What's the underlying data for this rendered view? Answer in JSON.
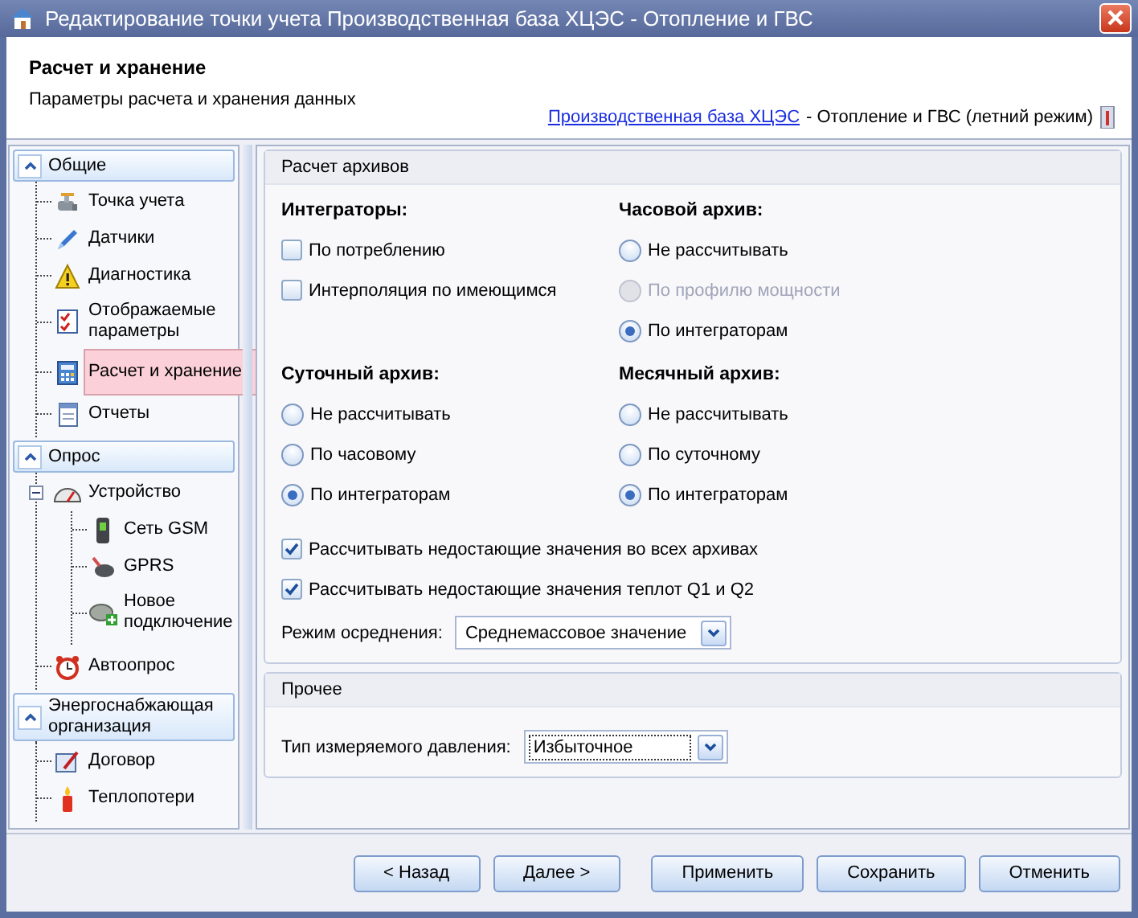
{
  "window": {
    "title": "Редактирование точки учета Производственная база ХЦЭС - Отопление и ГВС"
  },
  "header": {
    "title": "Расчет и хранение",
    "subtitle": "Параметры расчета и хранения данных",
    "link": "Производственная база ХЦЭС",
    "context": "- Отопление и ГВС (летний режим)"
  },
  "sidebar": {
    "groups": [
      {
        "label": "Общие",
        "expanded": true,
        "items": [
          {
            "label": "Точка учета",
            "selected": false
          },
          {
            "label": "Датчики",
            "selected": false
          },
          {
            "label": "Диагностика",
            "selected": false
          },
          {
            "label": "Отображаемые параметры",
            "selected": false
          },
          {
            "label": "Расчет и хранение",
            "selected": true
          },
          {
            "label": "Отчеты",
            "selected": false
          }
        ]
      },
      {
        "label": "Опрос",
        "expanded": true,
        "items": [
          {
            "label": "Устройство",
            "selected": false,
            "expanded": true,
            "children": [
              {
                "label": "Сеть GSM",
                "selected": false
              },
              {
                "label": "GPRS",
                "selected": false
              },
              {
                "label": "Новое подключение",
                "selected": false
              }
            ]
          },
          {
            "label": "Автоопрос",
            "selected": false
          }
        ]
      },
      {
        "label": "Энергоснабжающая организация",
        "expanded": true,
        "items": [
          {
            "label": "Договор",
            "selected": false
          },
          {
            "label": "Теплопотери",
            "selected": false
          }
        ]
      }
    ]
  },
  "sections": [
    {
      "title": "Расчет архивов",
      "groups": [
        {
          "title": "Интеграторы:",
          "kind": "checkbox",
          "options": [
            {
              "label": "По потреблению",
              "checked": false
            },
            {
              "label": "Интерполяция по имеющимся",
              "checked": false
            }
          ]
        },
        {
          "title": "Часовой архив:",
          "kind": "radio",
          "options": [
            {
              "label": "Не рассчитывать",
              "selected": false,
              "disabled": false
            },
            {
              "label": "По профилю мощности",
              "selected": false,
              "disabled": true
            },
            {
              "label": "По интеграторам",
              "selected": true,
              "disabled": false
            }
          ]
        },
        {
          "title": "Суточный архив:",
          "kind": "radio",
          "options": [
            {
              "label": "Не рассчитывать",
              "selected": false,
              "disabled": false
            },
            {
              "label": "По часовому",
              "selected": false,
              "disabled": false
            },
            {
              "label": "По интеграторам",
              "selected": true,
              "disabled": false
            }
          ]
        },
        {
          "title": "Месячный архив:",
          "kind": "radio",
          "options": [
            {
              "label": "Не рассчитывать",
              "selected": false,
              "disabled": false
            },
            {
              "label": "По суточному",
              "selected": false,
              "disabled": false
            },
            {
              "label": "По интеграторам",
              "selected": true,
              "disabled": false
            }
          ]
        }
      ],
      "checks": [
        {
          "label": "Рассчитывать недостающие значения во всех архивах",
          "checked": true
        },
        {
          "label": "Рассчитывать недостающие значения теплот Q1 и Q2",
          "checked": true
        }
      ],
      "fields": [
        {
          "label": "Режим осреднения:",
          "value": "Среднемассовое значение",
          "focused": false
        }
      ]
    },
    {
      "title": "Прочее",
      "fields": [
        {
          "label": "Тип измеряемого давления:",
          "value": "Избыточное",
          "focused": true
        }
      ]
    }
  ],
  "buttons": [
    {
      "label": "< Назад"
    },
    {
      "label": "Далее >"
    },
    {
      "label": "Применить"
    },
    {
      "label": "Сохранить"
    },
    {
      "label": "Отменить"
    }
  ]
}
